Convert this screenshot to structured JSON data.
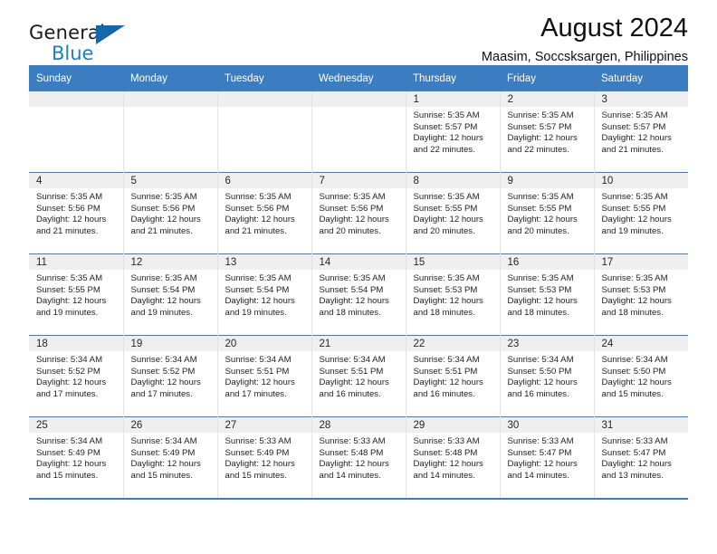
{
  "brand": {
    "name_part1": "General",
    "name_part2": "Blue",
    "logo_icon": "triangle-flag-icon"
  },
  "header": {
    "title": "August 2024",
    "subtitle": "Maasim, Soccsksargen, Philippines"
  },
  "weekday_headers": [
    "Sunday",
    "Monday",
    "Tuesday",
    "Wednesday",
    "Thursday",
    "Friday",
    "Saturday"
  ],
  "colors": {
    "header_blue": "#3b7dc0",
    "brand_blue": "#1a7fc1",
    "daynum_bg": "#efefef",
    "cell_border": "#e3e3e3"
  },
  "weeks": [
    [
      {
        "day": "",
        "empty": true,
        "sunrise": "",
        "sunset": "",
        "daylight1": "",
        "daylight2": ""
      },
      {
        "day": "",
        "empty": true,
        "sunrise": "",
        "sunset": "",
        "daylight1": "",
        "daylight2": ""
      },
      {
        "day": "",
        "empty": true,
        "sunrise": "",
        "sunset": "",
        "daylight1": "",
        "daylight2": ""
      },
      {
        "day": "",
        "empty": true,
        "sunrise": "",
        "sunset": "",
        "daylight1": "",
        "daylight2": ""
      },
      {
        "day": "1",
        "empty": false,
        "sunrise": "Sunrise: 5:35 AM",
        "sunset": "Sunset: 5:57 PM",
        "daylight1": "Daylight: 12 hours",
        "daylight2": "and 22 minutes."
      },
      {
        "day": "2",
        "empty": false,
        "sunrise": "Sunrise: 5:35 AM",
        "sunset": "Sunset: 5:57 PM",
        "daylight1": "Daylight: 12 hours",
        "daylight2": "and 22 minutes."
      },
      {
        "day": "3",
        "empty": false,
        "sunrise": "Sunrise: 5:35 AM",
        "sunset": "Sunset: 5:57 PM",
        "daylight1": "Daylight: 12 hours",
        "daylight2": "and 21 minutes."
      }
    ],
    [
      {
        "day": "4",
        "empty": false,
        "sunrise": "Sunrise: 5:35 AM",
        "sunset": "Sunset: 5:56 PM",
        "daylight1": "Daylight: 12 hours",
        "daylight2": "and 21 minutes."
      },
      {
        "day": "5",
        "empty": false,
        "sunrise": "Sunrise: 5:35 AM",
        "sunset": "Sunset: 5:56 PM",
        "daylight1": "Daylight: 12 hours",
        "daylight2": "and 21 minutes."
      },
      {
        "day": "6",
        "empty": false,
        "sunrise": "Sunrise: 5:35 AM",
        "sunset": "Sunset: 5:56 PM",
        "daylight1": "Daylight: 12 hours",
        "daylight2": "and 21 minutes."
      },
      {
        "day": "7",
        "empty": false,
        "sunrise": "Sunrise: 5:35 AM",
        "sunset": "Sunset: 5:56 PM",
        "daylight1": "Daylight: 12 hours",
        "daylight2": "and 20 minutes."
      },
      {
        "day": "8",
        "empty": false,
        "sunrise": "Sunrise: 5:35 AM",
        "sunset": "Sunset: 5:55 PM",
        "daylight1": "Daylight: 12 hours",
        "daylight2": "and 20 minutes."
      },
      {
        "day": "9",
        "empty": false,
        "sunrise": "Sunrise: 5:35 AM",
        "sunset": "Sunset: 5:55 PM",
        "daylight1": "Daylight: 12 hours",
        "daylight2": "and 20 minutes."
      },
      {
        "day": "10",
        "empty": false,
        "sunrise": "Sunrise: 5:35 AM",
        "sunset": "Sunset: 5:55 PM",
        "daylight1": "Daylight: 12 hours",
        "daylight2": "and 19 minutes."
      }
    ],
    [
      {
        "day": "11",
        "empty": false,
        "sunrise": "Sunrise: 5:35 AM",
        "sunset": "Sunset: 5:55 PM",
        "daylight1": "Daylight: 12 hours",
        "daylight2": "and 19 minutes."
      },
      {
        "day": "12",
        "empty": false,
        "sunrise": "Sunrise: 5:35 AM",
        "sunset": "Sunset: 5:54 PM",
        "daylight1": "Daylight: 12 hours",
        "daylight2": "and 19 minutes."
      },
      {
        "day": "13",
        "empty": false,
        "sunrise": "Sunrise: 5:35 AM",
        "sunset": "Sunset: 5:54 PM",
        "daylight1": "Daylight: 12 hours",
        "daylight2": "and 19 minutes."
      },
      {
        "day": "14",
        "empty": false,
        "sunrise": "Sunrise: 5:35 AM",
        "sunset": "Sunset: 5:54 PM",
        "daylight1": "Daylight: 12 hours",
        "daylight2": "and 18 minutes."
      },
      {
        "day": "15",
        "empty": false,
        "sunrise": "Sunrise: 5:35 AM",
        "sunset": "Sunset: 5:53 PM",
        "daylight1": "Daylight: 12 hours",
        "daylight2": "and 18 minutes."
      },
      {
        "day": "16",
        "empty": false,
        "sunrise": "Sunrise: 5:35 AM",
        "sunset": "Sunset: 5:53 PM",
        "daylight1": "Daylight: 12 hours",
        "daylight2": "and 18 minutes."
      },
      {
        "day": "17",
        "empty": false,
        "sunrise": "Sunrise: 5:35 AM",
        "sunset": "Sunset: 5:53 PM",
        "daylight1": "Daylight: 12 hours",
        "daylight2": "and 18 minutes."
      }
    ],
    [
      {
        "day": "18",
        "empty": false,
        "sunrise": "Sunrise: 5:34 AM",
        "sunset": "Sunset: 5:52 PM",
        "daylight1": "Daylight: 12 hours",
        "daylight2": "and 17 minutes."
      },
      {
        "day": "19",
        "empty": false,
        "sunrise": "Sunrise: 5:34 AM",
        "sunset": "Sunset: 5:52 PM",
        "daylight1": "Daylight: 12 hours",
        "daylight2": "and 17 minutes."
      },
      {
        "day": "20",
        "empty": false,
        "sunrise": "Sunrise: 5:34 AM",
        "sunset": "Sunset: 5:51 PM",
        "daylight1": "Daylight: 12 hours",
        "daylight2": "and 17 minutes."
      },
      {
        "day": "21",
        "empty": false,
        "sunrise": "Sunrise: 5:34 AM",
        "sunset": "Sunset: 5:51 PM",
        "daylight1": "Daylight: 12 hours",
        "daylight2": "and 16 minutes."
      },
      {
        "day": "22",
        "empty": false,
        "sunrise": "Sunrise: 5:34 AM",
        "sunset": "Sunset: 5:51 PM",
        "daylight1": "Daylight: 12 hours",
        "daylight2": "and 16 minutes."
      },
      {
        "day": "23",
        "empty": false,
        "sunrise": "Sunrise: 5:34 AM",
        "sunset": "Sunset: 5:50 PM",
        "daylight1": "Daylight: 12 hours",
        "daylight2": "and 16 minutes."
      },
      {
        "day": "24",
        "empty": false,
        "sunrise": "Sunrise: 5:34 AM",
        "sunset": "Sunset: 5:50 PM",
        "daylight1": "Daylight: 12 hours",
        "daylight2": "and 15 minutes."
      }
    ],
    [
      {
        "day": "25",
        "empty": false,
        "sunrise": "Sunrise: 5:34 AM",
        "sunset": "Sunset: 5:49 PM",
        "daylight1": "Daylight: 12 hours",
        "daylight2": "and 15 minutes."
      },
      {
        "day": "26",
        "empty": false,
        "sunrise": "Sunrise: 5:34 AM",
        "sunset": "Sunset: 5:49 PM",
        "daylight1": "Daylight: 12 hours",
        "daylight2": "and 15 minutes."
      },
      {
        "day": "27",
        "empty": false,
        "sunrise": "Sunrise: 5:33 AM",
        "sunset": "Sunset: 5:49 PM",
        "daylight1": "Daylight: 12 hours",
        "daylight2": "and 15 minutes."
      },
      {
        "day": "28",
        "empty": false,
        "sunrise": "Sunrise: 5:33 AM",
        "sunset": "Sunset: 5:48 PM",
        "daylight1": "Daylight: 12 hours",
        "daylight2": "and 14 minutes."
      },
      {
        "day": "29",
        "empty": false,
        "sunrise": "Sunrise: 5:33 AM",
        "sunset": "Sunset: 5:48 PM",
        "daylight1": "Daylight: 12 hours",
        "daylight2": "and 14 minutes."
      },
      {
        "day": "30",
        "empty": false,
        "sunrise": "Sunrise: 5:33 AM",
        "sunset": "Sunset: 5:47 PM",
        "daylight1": "Daylight: 12 hours",
        "daylight2": "and 14 minutes."
      },
      {
        "day": "31",
        "empty": false,
        "sunrise": "Sunrise: 5:33 AM",
        "sunset": "Sunset: 5:47 PM",
        "daylight1": "Daylight: 12 hours",
        "daylight2": "and 13 minutes."
      }
    ]
  ]
}
